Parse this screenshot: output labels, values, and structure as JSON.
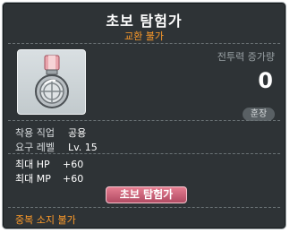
{
  "item": {
    "name": "초보 탐험가",
    "trade_status": "교환 불가",
    "icon": "medal-icon"
  },
  "combat_power": {
    "label": "전투력 증가량",
    "value": "0"
  },
  "category_badge": "훈장",
  "requirements": [
    {
      "label": "착용 직업",
      "value": "공용"
    },
    {
      "label": "요구 레벨",
      "value": "Lv. 15"
    }
  ],
  "stats": [
    {
      "label": "최대 HP",
      "value": "+60"
    },
    {
      "label": "최대 MP",
      "value": "+60"
    }
  ],
  "set_button_label": "초보 탐험가",
  "ownership_note": "중복 소지 불가",
  "colors": {
    "background": "#2e3336",
    "accent_orange": "#ff9c2a",
    "button_pink": "#c95e76",
    "ribbon_pink": "#e9a5ad"
  }
}
